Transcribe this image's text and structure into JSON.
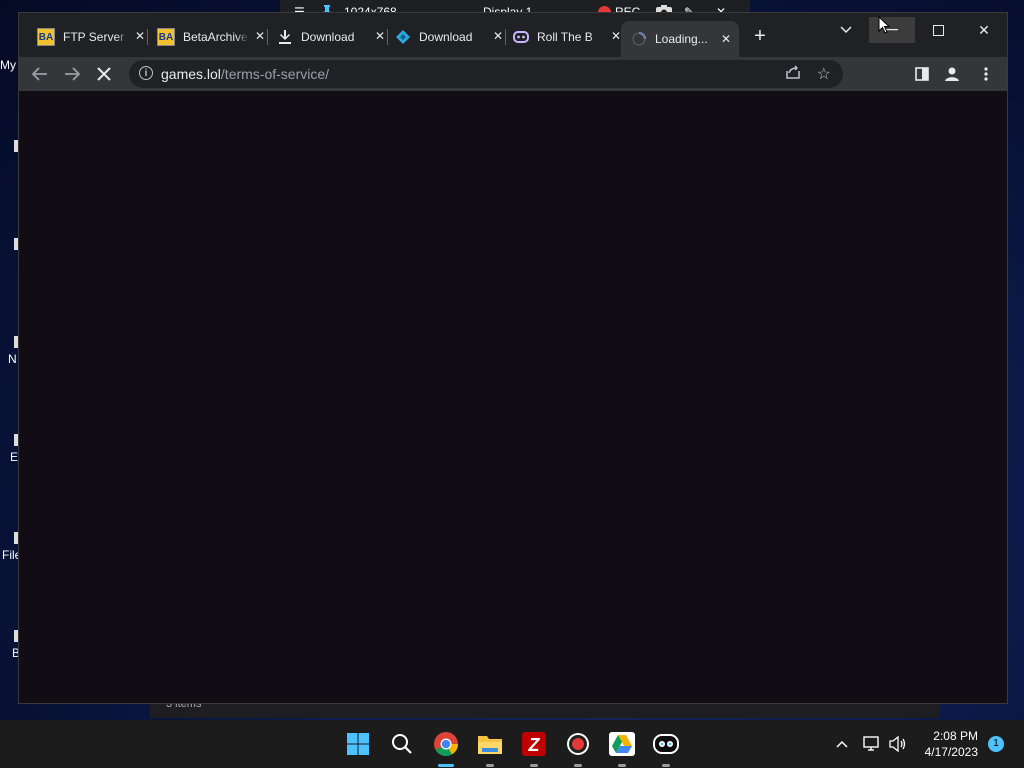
{
  "remote_toolbar": {
    "resolution": "1024x768",
    "display": "Display 1",
    "rec_label": "REC"
  },
  "desktop": {
    "labels": [
      "My",
      "N",
      "E",
      "File",
      "B"
    ],
    "explorer_status": "3 items"
  },
  "browser": {
    "tabs": [
      {
        "title": "FTP Server",
        "favicon": "betaarchive-icon"
      },
      {
        "title": "BetaArchive",
        "favicon": "betaarchive-icon"
      },
      {
        "title": "Download",
        "favicon": "download-icon"
      },
      {
        "title": "Download",
        "favicon": "diamond-logo-icon"
      },
      {
        "title": "Roll The B",
        "favicon": "discord-like-icon"
      },
      {
        "title": "Loading...",
        "favicon": "loading-spinner-icon"
      }
    ],
    "active_tab_index": 5,
    "address": {
      "domain": "games.lol",
      "path": "/terms-of-service/"
    }
  },
  "taskbar": {
    "apps": [
      "windows-start",
      "search",
      "chrome",
      "file-explorer",
      "filezilla",
      "recorder",
      "google-drive",
      "game-app"
    ],
    "time": "2:08 PM",
    "date": "4/17/2023",
    "notification_count": "1"
  },
  "colors": {
    "page_bg": "#120d14",
    "tab_strip": "#202124",
    "toolbar": "#35363a",
    "accent": "#4cc2ff"
  }
}
